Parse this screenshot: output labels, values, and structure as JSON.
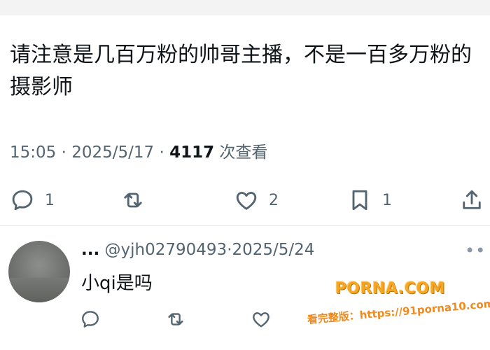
{
  "tweet": {
    "text": "请注意是几百万粉的帅哥主播，不是一百多万粉的摄影师",
    "time": "15:05",
    "sep1": " · ",
    "date": "2025/5/17",
    "sep2": " · ",
    "views_count": "4117",
    "views_label": " 次查看"
  },
  "actions": {
    "reply_count": "1",
    "retweet_count": "",
    "like_count": "2",
    "bookmark_count": "1"
  },
  "reply": {
    "name": "...",
    "handle": "@yjh02790493",
    "sep": "·",
    "date": "2025/5/24",
    "text": "小qi是吗",
    "more": "••"
  },
  "watermark": {
    "logo": "PORNA.COM",
    "line": "看完整版：https://91porna10.com"
  },
  "colors": {
    "text": "#0f1419",
    "secondary": "#536471",
    "icon": "#536471",
    "watermark": "#f5a623"
  },
  "icons": [
    "reply-icon",
    "retweet-icon",
    "like-icon",
    "bookmark-icon",
    "share-icon",
    "more-icon"
  ]
}
